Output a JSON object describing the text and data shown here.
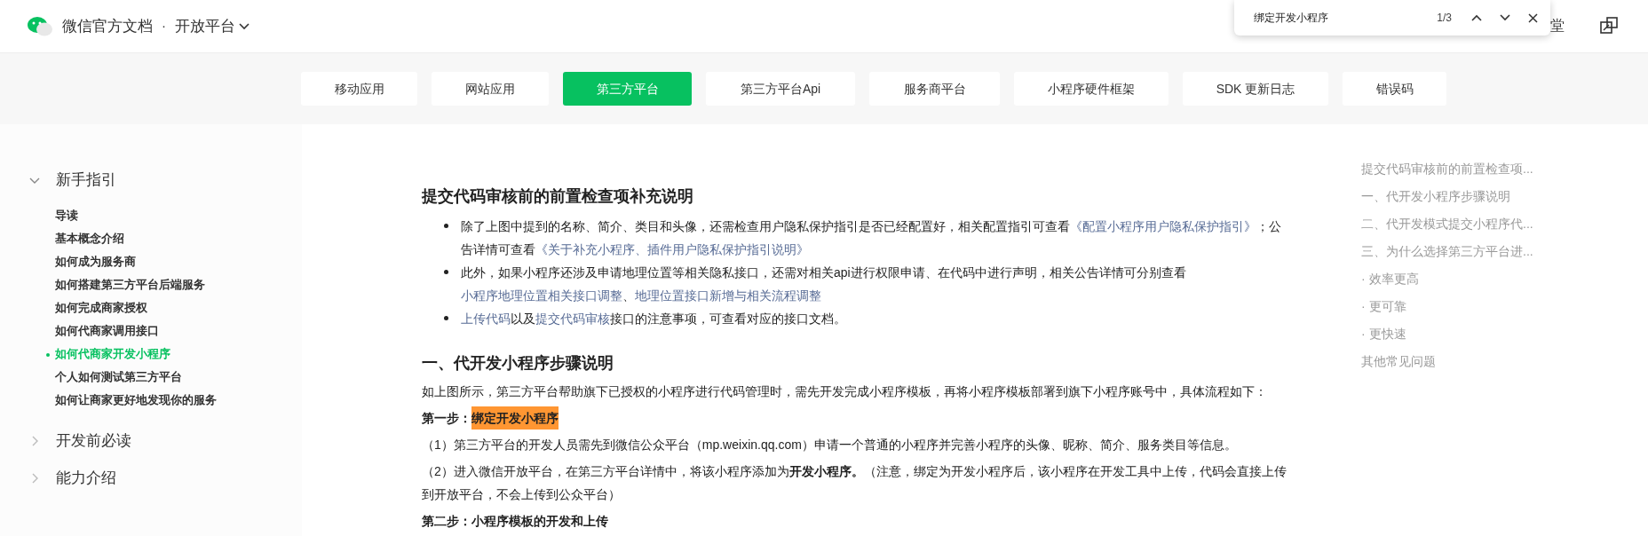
{
  "header": {
    "site_title": "微信官方文档",
    "separator": "·",
    "section": "开放平台",
    "right_text": "堂"
  },
  "find_bar": {
    "query": "绑定开发小程序",
    "count": "1/3"
  },
  "tabs": [
    {
      "label": "移动应用",
      "selected": false
    },
    {
      "label": "网站应用",
      "selected": false
    },
    {
      "label": "第三方平台",
      "selected": true
    },
    {
      "label": "第三方平台Api",
      "selected": false
    },
    {
      "label": "服务商平台",
      "selected": false
    },
    {
      "label": "小程序硬件框架",
      "selected": false
    },
    {
      "label": "SDK 更新日志",
      "selected": false
    },
    {
      "label": "错误码",
      "selected": false
    }
  ],
  "sidebar": {
    "groups": [
      {
        "title": "新手指引",
        "expanded": true,
        "children": [
          {
            "label": "导读",
            "selected": false
          },
          {
            "label": "基本概念介绍",
            "selected": false
          },
          {
            "label": "如何成为服务商",
            "selected": false
          },
          {
            "label": "如何搭建第三方平台后端服务",
            "selected": false
          },
          {
            "label": "如何完成商家授权",
            "selected": false
          },
          {
            "label": "如何代商家调用接口",
            "selected": false
          },
          {
            "label": "如何代商家开发小程序",
            "selected": true
          },
          {
            "label": "个人如何测试第三方平台",
            "selected": false
          },
          {
            "label": "如何让商家更好地发现你的服务",
            "selected": false
          }
        ]
      },
      {
        "title": "开发前必读",
        "expanded": false
      },
      {
        "title": "能力介绍",
        "expanded": false
      }
    ]
  },
  "content": {
    "blocks": [
      {
        "kind": "heading",
        "text": "提交代码审核前的前置检查项补充说明"
      },
      {
        "kind": "bullets",
        "items": [
          [
            {
              "kind": "text",
              "text": "除了上图中提到的名称、简介、类目和头像，还需检查用户隐私保护指引是否已经配置好，相关配置指引可查看"
            },
            {
              "kind": "link",
              "text": "《配置小程序用户隐私保护指引》"
            },
            {
              "kind": "text",
              "text": "；公告详情可查看"
            },
            {
              "kind": "link",
              "text": "《关于补充小程序、插件用户隐私保护指引说明》"
            }
          ],
          [
            {
              "kind": "text",
              "text": "此外，如果小程序还涉及申请地理位置等相关隐私接口，还需对相关api进行权限申请、在代码中进行声明，相关公告详情可分别查看"
            },
            {
              "kind": "link",
              "text": "小程序地理位置相关接口调整"
            },
            {
              "kind": "text",
              "text": "、"
            },
            {
              "kind": "link",
              "text": "地理位置接口新增与相关流程调整"
            }
          ],
          [
            {
              "kind": "link",
              "text": "上传代码"
            },
            {
              "kind": "text",
              "text": "以及"
            },
            {
              "kind": "link",
              "text": "提交代码审核"
            },
            {
              "kind": "text",
              "text": "接口的注意事项，可查看对应的接口文档。"
            }
          ]
        ]
      },
      {
        "kind": "heading",
        "text": "一、代开发小程序步骤说明"
      },
      {
        "kind": "paragraph",
        "text": "如上图所示，第三方平台帮助旗下已授权的小程序进行代码管理时，需先开发完成小程序模板，再将小程序模板部署到旗下小程序账号中，具体流程如下："
      },
      {
        "kind": "step",
        "label": "第一步：",
        "text": "绑定开发小程序",
        "highlighted": true
      },
      {
        "kind": "paragraph",
        "text": "（1）第三方平台的开发人员需先到微信公众平台（mp.weixin.qq.com）申请一个普通的小程序并完善小程序的头像、昵称、简介、服务类目等信息。"
      },
      {
        "kind": "paragraph",
        "text": "（2）进入微信开放平台，在第三方平台详情中，将该小程序添加为**开发小程序。**（注意，绑定为开发小程序后，该小程序在开发工具中上传，代码会直接上传到开放平台，不会上传到公众平台）"
      },
      {
        "kind": "step",
        "label": "第二步：",
        "text": "小程序模板的开发和上传",
        "highlighted": false
      }
    ]
  },
  "toc": [
    "提交代码审核前的前置检查项...",
    "一、代开发小程序步骤说明",
    "二、代开发模式提交小程序代...",
    "三、为什么选择第三方平台进...",
    "· 效率更高",
    "· 更可靠",
    "· 更快速",
    "其他常见问题"
  ]
}
